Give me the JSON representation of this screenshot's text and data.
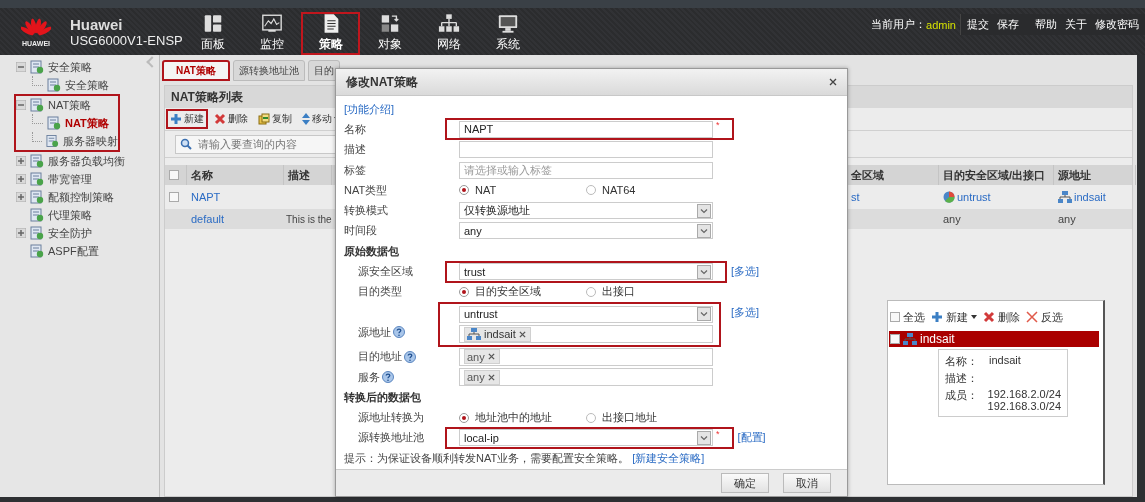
{
  "header": {
    "logo_text": "HUAWEI",
    "brand": "Huawei",
    "model": "USG6000V1-ENSP",
    "nav": [
      {
        "label": "面板",
        "selected": false
      },
      {
        "label": "监控",
        "selected": false
      },
      {
        "label": "策略",
        "selected": true
      },
      {
        "label": "对象",
        "selected": false
      },
      {
        "label": "网络",
        "selected": false
      },
      {
        "label": "系统",
        "selected": false
      }
    ],
    "user_label": "当前用户：",
    "user": "admin",
    "links": [
      "提交",
      "保存",
      "帮助",
      "关于",
      "修改密码"
    ]
  },
  "sidebar": {
    "items": [
      {
        "label": "安全策略",
        "expanded": true,
        "selected": false,
        "children": [
          {
            "label": "安全策略",
            "selected": false
          }
        ]
      },
      {
        "label": "NAT策略",
        "expanded": true,
        "highlighted": true,
        "selected": false,
        "children": [
          {
            "label": "NAT策略",
            "selected": true
          },
          {
            "label": "服务器映射",
            "selected": false
          }
        ]
      },
      {
        "label": "服务器负载均衡",
        "expanded": false,
        "selected": false
      },
      {
        "label": "带宽管理",
        "expanded": false,
        "selected": false
      },
      {
        "label": "配额控制策略",
        "expanded": false,
        "selected": false
      },
      {
        "label": "代理策略",
        "selected": false
      },
      {
        "label": "安全防护",
        "expanded": false,
        "selected": false
      },
      {
        "label": "ASPF配置",
        "selected": false
      }
    ]
  },
  "tabs": [
    {
      "label": "NAT策略",
      "selected": true
    },
    {
      "label": "源转换地址池",
      "selected": false
    },
    {
      "label": "目的",
      "selected": false
    }
  ],
  "panel": {
    "title": "NAT策略列表",
    "toolbar": [
      {
        "kind": "new",
        "label": "新建",
        "highlighted": true
      },
      {
        "kind": "delete",
        "label": "删除",
        "highlighted": false
      },
      {
        "kind": "copy",
        "label": "复制",
        "highlighted": false
      },
      {
        "kind": "move",
        "label": "移动",
        "menu": true,
        "highlighted": false
      }
    ],
    "search": {
      "placeholder": "请输入要查询的内容"
    },
    "table": {
      "all_checked": false,
      "columns": [
        "名称",
        "描述",
        "全区域",
        "目的安全区域/出接口",
        "源地址"
      ],
      "rows": [
        {
          "checked": false,
          "cells": [
            {
              "kind": "link",
              "text": "NAPT"
            },
            null,
            {
              "kind": "link",
              "text": "st"
            },
            {
              "kind": "zone",
              "text": "untrust"
            },
            {
              "kind": "address",
              "text": "indsait"
            }
          ]
        },
        {
          "cells": [
            {
              "kind": "link",
              "text": "default"
            },
            {
              "kind": "text",
              "text": "This is the"
            },
            null,
            {
              "kind": "text",
              "text": "any"
            },
            {
              "kind": "text",
              "text": "any"
            }
          ]
        }
      ]
    }
  },
  "dialog": {
    "title": "修改NAT策略",
    "rows": [
      {
        "kind": "link",
        "text": "[功能介绍]"
      },
      {
        "kind": "input",
        "label": "名称",
        "value": "NAPT",
        "required_mark": "*",
        "highlighted": true
      },
      {
        "kind": "input",
        "label": "描述"
      },
      {
        "kind": "input",
        "label": "标签",
        "placeholder": "请选择或输入标签"
      },
      {
        "kind": "radio",
        "label": "NAT类型",
        "options": [
          {
            "label": "NAT",
            "selected": true
          },
          {
            "label": "NAT64",
            "selected": false
          }
        ]
      },
      {
        "kind": "select",
        "label": "转换模式",
        "value": "仅转换源地址"
      },
      {
        "kind": "select",
        "label": "时间段",
        "value": "any"
      },
      {
        "kind": "section",
        "label": "原始数据包",
        "rows": [
          {
            "kind": "select",
            "label": "源安全区域",
            "value": "trust",
            "link": "[多选]",
            "highlighted": true
          },
          {
            "kind": "radio",
            "label": "目的类型",
            "options": [
              {
                "label": "目的安全区域",
                "selected": true
              },
              {
                "label": "出接口",
                "selected": false
              }
            ]
          },
          {
            "kind": "group",
            "highlighted": true,
            "rows": [
              {
                "kind": "select",
                "value": "untrust",
                "link": "[多选]"
              },
              {
                "kind": "tags",
                "label": "源地址",
                "help": true,
                "tags": [
                  {
                    "kind": "address",
                    "text": "indsait"
                  }
                ]
              }
            ]
          },
          {
            "kind": "tags",
            "label": "目的地址",
            "help": true,
            "tags": [
              {
                "kind": "plain",
                "text": "any"
              }
            ]
          },
          {
            "kind": "tags",
            "label": "服务",
            "help": true,
            "tags": [
              {
                "kind": "plain",
                "text": "any"
              }
            ]
          }
        ]
      },
      {
        "kind": "section",
        "label": "转换后的数据包",
        "rows": [
          {
            "kind": "radio",
            "label": "源地址转换为",
            "options": [
              {
                "label": "地址池中的地址",
                "selected": true
              },
              {
                "label": "出接口地址",
                "selected": false
              }
            ]
          },
          {
            "kind": "select",
            "label": "源转换地址池",
            "value": "local-ip",
            "required_mark": "*",
            "link": "[配置]",
            "highlighted": true
          }
        ]
      },
      {
        "kind": "hint",
        "text": "提示：为保证设备顺利转发NAT业务，需要配置安全策略。",
        "link": "[新建安全策略]"
      }
    ],
    "buttons": [
      "确定",
      "取消"
    ]
  },
  "address_popup": {
    "select_all": {
      "label": "全选",
      "checked": false
    },
    "actions": [
      {
        "kind": "new",
        "label": "新建",
        "menu": true
      },
      {
        "kind": "delete",
        "label": "删除"
      },
      {
        "kind": "invert",
        "label": "反选"
      }
    ],
    "items": [
      {
        "name": "indsait",
        "selected": true,
        "checked": false
      }
    ],
    "details": [
      {
        "label": "名称：",
        "values": [
          "indsait"
        ]
      },
      {
        "label": "描述："
      },
      {
        "label": "成员：",
        "values": [
          "192.168.2.0/24",
          "192.168.3.0/24"
        ]
      }
    ]
  }
}
